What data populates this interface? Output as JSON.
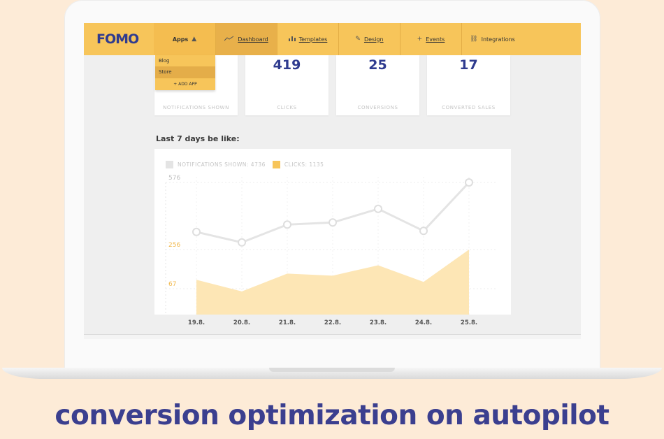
{
  "nav": {
    "logo": "FOMO",
    "apps_label": "Apps",
    "items": [
      {
        "label": "Dashboard",
        "icon": "trend-icon"
      },
      {
        "label": "Templates",
        "icon": "bars-icon"
      },
      {
        "label": "Design",
        "icon": "edit-icon"
      },
      {
        "label": "Events",
        "icon": "plus-icon"
      },
      {
        "label": "Integrations",
        "icon": "link-icon"
      }
    ]
  },
  "dropdown": {
    "items": [
      "Blog",
      "Store"
    ],
    "add_label": "+ ADD APP"
  },
  "stats": [
    {
      "value": "",
      "caption": "NOTIFICATIONS SHOWN"
    },
    {
      "value": "419",
      "caption": "CLICKS"
    },
    {
      "value": "25",
      "caption": "CONVERSIONS"
    },
    {
      "value": "17",
      "caption": "CONVERTED SALES"
    }
  ],
  "section_title": "Last 7 days be like:",
  "legend": {
    "notifications": "NOTIFICATIONS SHOWN: 4736",
    "clicks": "CLICKS: 1135"
  },
  "chart_data": {
    "type": "line",
    "categories": [
      "19.8.",
      "20.8.",
      "21.8.",
      "22.8.",
      "23.8.",
      "24.8.",
      "25.8."
    ],
    "series": [
      {
        "name": "NOTIFICATIONS SHOWN",
        "values": [
          340,
          290,
          375,
          385,
          450,
          345,
          576
        ]
      },
      {
        "name": "CLICKS",
        "values": [
          110,
          60,
          140,
          130,
          180,
          100,
          256
        ]
      }
    ],
    "y_ticks": [
      67,
      256,
      576
    ],
    "colors": {
      "notifications": "#e4e4e4",
      "clicks": "#fde6b5"
    }
  },
  "tagline": "conversion optimization on autopilot",
  "colors": {
    "brand_yellow": "#f7c55a",
    "brand_navy": "#2f3b8f",
    "background": "#fdebd7"
  }
}
